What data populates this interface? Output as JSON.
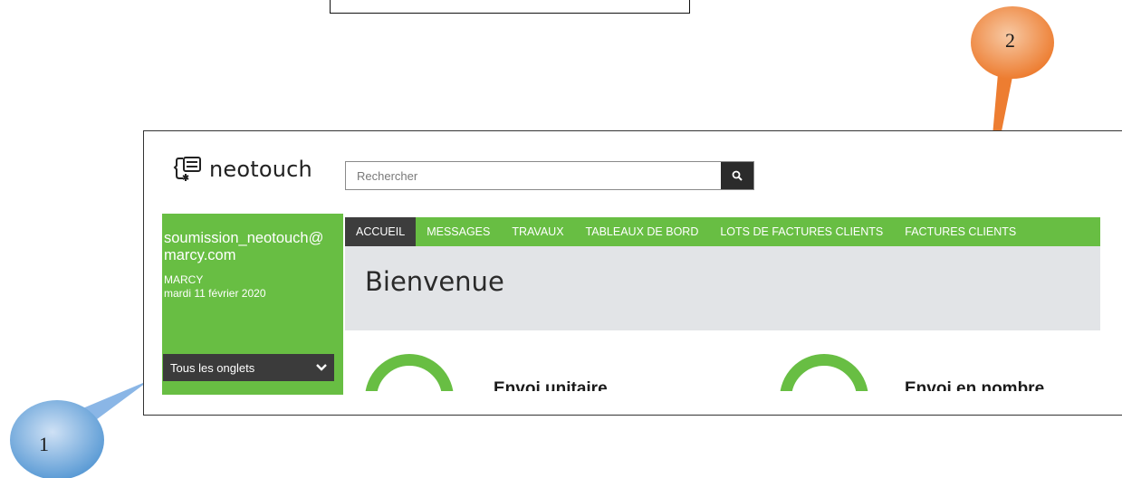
{
  "logo": {
    "text": "neotouch"
  },
  "search": {
    "placeholder": "Rechercher"
  },
  "sidebar": {
    "email": "soumission_neotouch@marcy.com",
    "company": "MARCY",
    "date": "mardi 11 février 2020",
    "tabs_select_label": "Tous les onglets"
  },
  "nav": {
    "items": [
      {
        "label": "ACCUEIL"
      },
      {
        "label": "MESSAGES"
      },
      {
        "label": "TRAVAUX"
      },
      {
        "label": "TABLEAUX DE BORD"
      },
      {
        "label": "LOTS DE FACTURES CLIENTS"
      },
      {
        "label": "FACTURES CLIENTS"
      }
    ]
  },
  "welcome": {
    "title": "Bienvenue"
  },
  "cards": [
    {
      "title": "Envoi unitaire"
    },
    {
      "title": "Envoi en nombre"
    }
  ],
  "callouts": [
    {
      "number": "1",
      "color": "#5b9bd5"
    },
    {
      "number": "2",
      "color": "#ed7d31"
    }
  ],
  "colors": {
    "brand_green": "#68be43",
    "dark": "#3d3d3d"
  }
}
